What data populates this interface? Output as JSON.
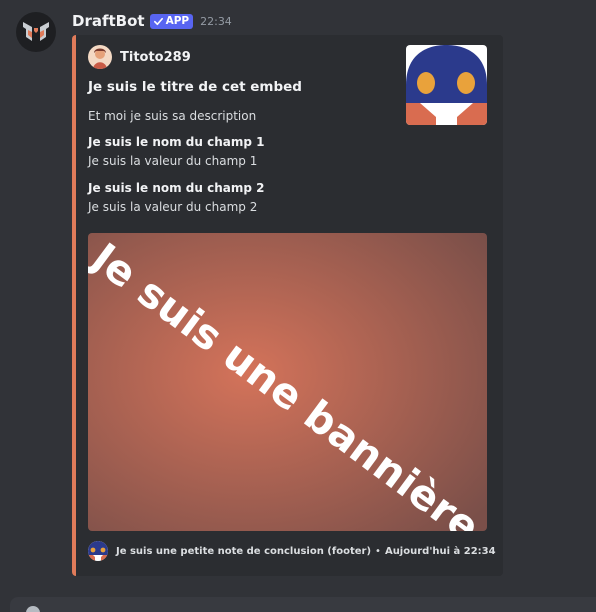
{
  "message": {
    "author": "DraftBot",
    "badge": "APP",
    "timestamp": "22:34",
    "avatar_icon": "draftbot-logo-icon"
  },
  "embed": {
    "accent_color": "#e07b5a",
    "author_name": "Titoto289",
    "title": "Je suis le titre de cet embed",
    "description": "Et moi je suis sa description",
    "fields": [
      {
        "name": "Je suis le nom du champ 1",
        "value": "Je suis la valeur du champ 1"
      },
      {
        "name": "Je suis le nom du champ 2",
        "value": "Je suis la valeur du champ 2"
      }
    ],
    "image_text": "Je suis une bannière",
    "footer_text": "Je suis une petite note de conclusion (footer)",
    "footer_separator": "•",
    "footer_time": "Aujourd'hui à 22:34"
  },
  "colors": {
    "background": "#313338",
    "embed_background": "#2b2d31",
    "badge": "#5865f2",
    "banner_center": "#d4735a",
    "banner_edge": "#7a4f49"
  }
}
